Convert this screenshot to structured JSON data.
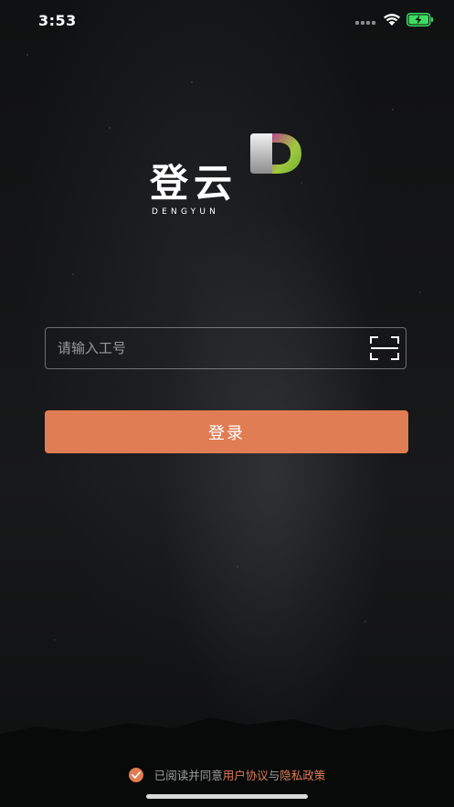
{
  "status_bar": {
    "time": "3:53"
  },
  "logo": {
    "text": "登云",
    "subtext": "DENGYUN",
    "mark_letter": "D"
  },
  "login": {
    "input_placeholder": "请输入工号",
    "input_value": "",
    "button_label": "登录"
  },
  "agreement": {
    "prefix": "已阅读并同意",
    "user_agreement": "用户协议",
    "conjunction": "与",
    "privacy_policy": "隐私政策",
    "checked": true
  },
  "colors": {
    "accent": "#e07d54",
    "battery": "#3ddc5f"
  },
  "icons": [
    "signal-icon",
    "wifi-icon",
    "battery-charging-icon",
    "scan-icon",
    "check-icon",
    "logo-mark-icon"
  ]
}
